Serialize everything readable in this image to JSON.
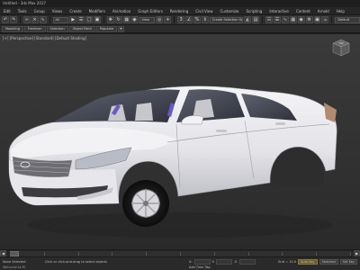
{
  "window": {
    "title": "Untitled - 3ds Max 2017"
  },
  "menu": {
    "items": [
      "Edit",
      "Tools",
      "Group",
      "Views",
      "Create",
      "Modifiers",
      "Animation",
      "Graph Editors",
      "Rendering",
      "Civil View",
      "Customize",
      "Scripting",
      "Interactive",
      "Content",
      "Arnold",
      "Help"
    ]
  },
  "toolbar": {
    "selection_filter": "All",
    "viewport_mode": "View",
    "named_selection": "Create Selection Set",
    "workspace": "Default"
  },
  "ribbon": {
    "tabs": [
      "Modeling",
      "Freeform",
      "Selection",
      "Object Paint",
      "Populate"
    ]
  },
  "viewport": {
    "label": "[+] [Perspective] [Standard] [Default Shading]",
    "viewcube_label": "TOP"
  },
  "timeline": {
    "frame": "0 / 100",
    "ticks": [
      "0",
      "10",
      "20",
      "30",
      "40",
      "50",
      "60",
      "70",
      "80",
      "90",
      "100"
    ]
  },
  "status": {
    "selection": "None Selected",
    "hint": "Click or click-and-drag to select objects",
    "x_label": "X:",
    "x_value": "",
    "y_label": "Y:",
    "y_value": "",
    "z_label": "Z:",
    "z_value": "",
    "grid": "Grid = 10.0",
    "auto_key": "Auto Key",
    "set_key": "Set Key",
    "selected": "Selected",
    "add_time_tag": "Add Time Tag",
    "welcome": "Welcome to M"
  },
  "colors": {
    "accent": "#6a5b2c",
    "viewport_bg": "#333333",
    "car_body": "#e9e9ee"
  }
}
